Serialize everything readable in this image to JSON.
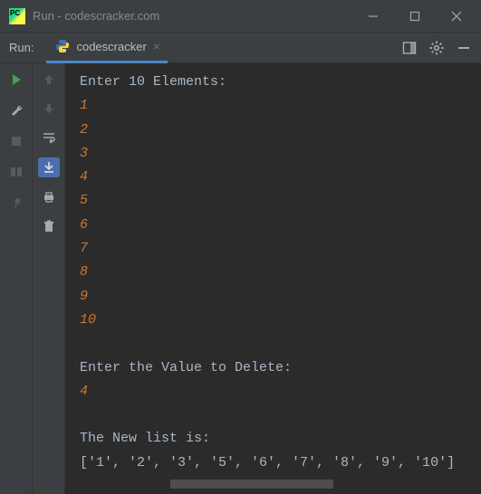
{
  "window": {
    "title": "Run - codescracker.com"
  },
  "tabbar": {
    "run_label": "Run:",
    "tab_name": "codescracker",
    "tab_close": "×"
  },
  "console": {
    "prompt_enter": "Enter 10 Elements: ",
    "inputs": [
      "1",
      "2",
      "3",
      "4",
      "5",
      "6",
      "7",
      "8",
      "9",
      "10"
    ],
    "prompt_delete": "Enter the Value to Delete: ",
    "delete_value": "4",
    "result_label": "The New list is: ",
    "result_value": "['1', '2', '3', '5', '6', '7', '8', '9', '10']"
  }
}
